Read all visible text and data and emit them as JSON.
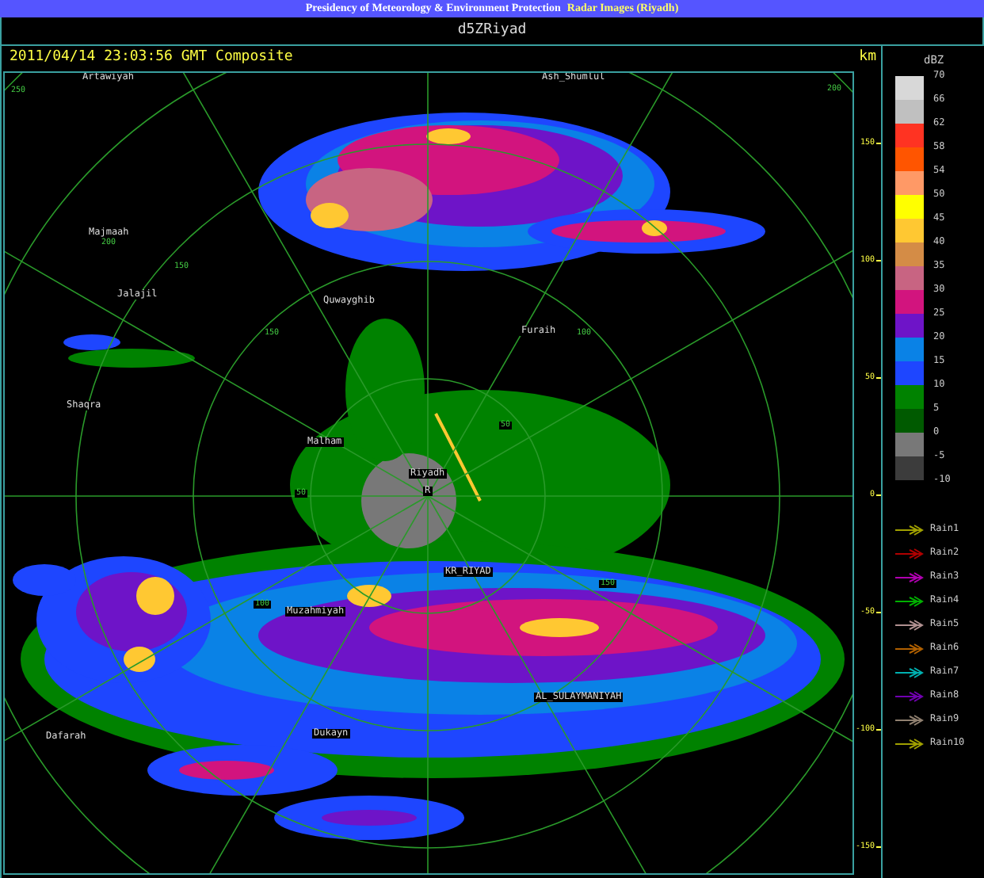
{
  "header": {
    "title": "Presidency of Meteorology & Environment Protection",
    "subtitle": "Radar Images (Riyadh)"
  },
  "product": "d5ZRiyad",
  "timestamp": "2011/04/14 23:03:56 GMT Composite",
  "axis": {
    "unit": "km",
    "ticks": [
      "150",
      "100",
      "50",
      "0",
      "-50",
      "-100",
      "-150"
    ]
  },
  "map": {
    "place_labels": [
      "Artawiyah",
      "Ash_Shumlul",
      "Majmaah",
      "Jalajil",
      "Quwayghib",
      "Furaih",
      "Shaqra",
      "Malham",
      "Riyadh",
      "R",
      "KR_RIYAD",
      "Muzahmiyah",
      "AL_SULAYMANIYAH",
      "Dafarah",
      "Dukayn"
    ],
    "range_labels": [
      "250",
      "200",
      "150",
      "150",
      "200",
      "100",
      "150",
      "50",
      "50",
      "100"
    ]
  },
  "legend": {
    "unit": "dBZ",
    "bands": [
      {
        "label": "70",
        "color": "#d8d8d8"
      },
      {
        "label": "66",
        "color": "#c0c0c0"
      },
      {
        "label": "62",
        "color": "#ff3322"
      },
      {
        "label": "58",
        "color": "#ff5500"
      },
      {
        "label": "54",
        "color": "#ff9966"
      },
      {
        "label": "50",
        "color": "#ffff00"
      },
      {
        "label": "45",
        "color": "#ffc832"
      },
      {
        "label": "40",
        "color": "#d48c46"
      },
      {
        "label": "35",
        "color": "#c86482"
      },
      {
        "label": "30",
        "color": "#d2147e"
      },
      {
        "label": "25",
        "color": "#6e14c8"
      },
      {
        "label": "20",
        "color": "#0a82e6"
      },
      {
        "label": "15",
        "color": "#1e46ff"
      },
      {
        "label": "10",
        "color": "#008200"
      },
      {
        "label": "5",
        "color": "#005a00"
      },
      {
        "label": "0",
        "color": "#787878"
      },
      {
        "label": "-5",
        "color": "#3c3c3c"
      }
    ],
    "bottom_label": "-10",
    "tracks": [
      {
        "label": "Rain1",
        "color": "#a0a000"
      },
      {
        "label": "Rain2",
        "color": "#b00000"
      },
      {
        "label": "Rain3",
        "color": "#b000b0"
      },
      {
        "label": "Rain4",
        "color": "#00b000"
      },
      {
        "label": "Rain5",
        "color": "#b09090"
      },
      {
        "label": "Rain6",
        "color": "#b06000"
      },
      {
        "label": "Rain7",
        "color": "#00b0b0"
      },
      {
        "label": "Rain8",
        "color": "#7000b0"
      },
      {
        "label": "Rain9",
        "color": "#908070"
      },
      {
        "label": "Rain10",
        "color": "#a0a000"
      }
    ]
  }
}
